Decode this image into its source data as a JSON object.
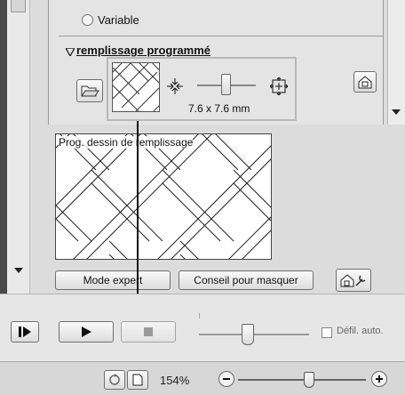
{
  "radio_variable_label": "Variable",
  "section_title": "remplissage programmé",
  "pattern_size": "7.6 x 7.6 mm",
  "preview_caption": "Prog. dessin de remplissage",
  "expert_mode_button": "Mode expert",
  "hide_tip_button": "Conseil pour masquer",
  "auto_scroll_label": "Défil. auto.",
  "zoom_level": "154%",
  "zoom_slider_position": 0.55,
  "speed_slider_position": 0.5,
  "icons": {
    "open": "folder-open-icon",
    "shrink": "shrink-arrows-icon",
    "expand": "expand-arrows-icon",
    "house": "house-icon",
    "house_wrench": "house-wrench-icon",
    "play": "play-icon",
    "step": "step-forward-icon",
    "stop": "stop-icon",
    "zoom_out": "zoom-out-icon",
    "zoom_in": "zoom-in-icon"
  }
}
